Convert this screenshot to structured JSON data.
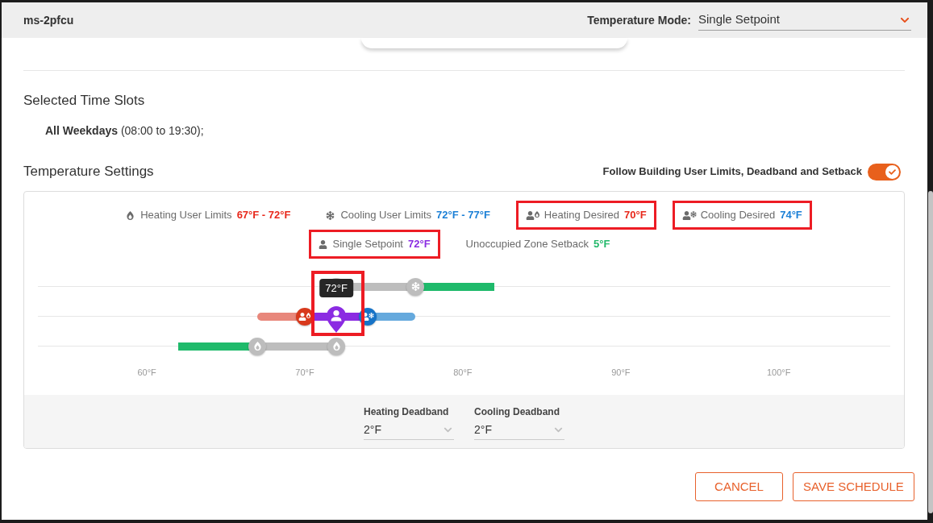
{
  "header": {
    "title": "ms-2pfcu",
    "mode_label": "Temperature Mode:",
    "mode_value": "Single Setpoint"
  },
  "selected_time_slots": {
    "heading": "Selected Time Slots",
    "summary": "**All Weekdays** (08:00 to 19:30);"
  },
  "temperature_settings": {
    "heading": "Temperature Settings",
    "follow_building": {
      "label": "Follow Building User Limits, Deadband and Setback",
      "on": true
    },
    "legend": {
      "rows": [
        {
          "items": [
            {
              "kind": "heating_limits",
              "label": "Heating User Limits",
              "value": "67°F - 72°F",
              "color": "#e8291c",
              "highlighted": false
            },
            {
              "kind": "cooling_limits",
              "label": "Cooling User Limits",
              "value": "72°F - 77°F",
              "color": "#1a7fd6",
              "highlighted": false
            },
            {
              "kind": "heating_desired",
              "label": "Heating Desired",
              "value": "70°F",
              "color": "#e8291c",
              "highlighted": true
            },
            {
              "kind": "cooling_desired",
              "label": "Cooling Desired",
              "value": "74°F",
              "color": "#1a7fd6",
              "highlighted": true
            }
          ]
        },
        {
          "items": [
            {
              "kind": "setpoint",
              "label": "Single Setpoint",
              "value": "72°F",
              "color": "#8a2be2",
              "highlighted": true
            },
            {
              "kind": "setback",
              "label": "Unoccupied Zone Setback",
              "value": "5°F",
              "color": "#22b86a",
              "highlighted": false
            }
          ]
        }
      ]
    },
    "chart": {
      "tracks": [
        {
          "bars": [
            {
              "kind": "limit",
              "start": {
                "level": 0.3502
              },
              "end": {
                "level": 0.4429
              }
            },
            {
              "kind": "setback",
              "start": {
                "level": 0.4429
              },
              "end": {
                "level": 0.5355
              }
            }
          ],
          "handles": [
            {
              "kind": "cooling_limit",
              "level": 0.3502
            },
            {
              "kind": "cooling_limit",
              "level": 0.4429
            }
          ]
        },
        {
          "bars": [
            {
              "kind": "heating",
              "start": {
                "level": 0.2576
              },
              "end": {
                "level": 0.3132
              }
            },
            {
              "kind": "setpoint",
              "start": {
                "level": 0.3132
              },
              "end": {
                "level": 0.3873
              }
            },
            {
              "kind": "cooling",
              "start": {
                "level": 0.3873
              },
              "end": {
                "level": 0.4429
              }
            }
          ],
          "handles": [
            {
              "kind": "heating_desired",
              "level": 0.3132
            },
            {
              "kind": "setpoint",
              "level": 0.3502,
              "tooltip": "72°F",
              "highlighted": true
            },
            {
              "kind": "cooling_desired",
              "level": 0.3873
            }
          ]
        },
        {
          "bars": [
            {
              "kind": "setback",
              "start": {
                "level": 0.1649
              },
              "end": {
                "level": 0.2576
              }
            },
            {
              "kind": "limit",
              "start": {
                "level": 0.2576
              },
              "end": {
                "level": 0.3502
              }
            }
          ],
          "handles": [
            {
              "kind": "heating_limit",
              "level": 0.2576
            },
            {
              "kind": "heating_limit",
              "level": 0.3502
            }
          ]
        }
      ],
      "ticks": [
        "60°F",
        "70°F",
        "80°F",
        "90°F",
        "100°F"
      ]
    },
    "deadbands": [
      {
        "label": "Heating Deadband",
        "value": "2°F"
      },
      {
        "label": "Cooling Deadband",
        "value": "2°F"
      }
    ]
  },
  "buttons": [
    {
      "label": "CANCEL"
    },
    {
      "label": "SAVE SCHEDULE"
    }
  ]
}
